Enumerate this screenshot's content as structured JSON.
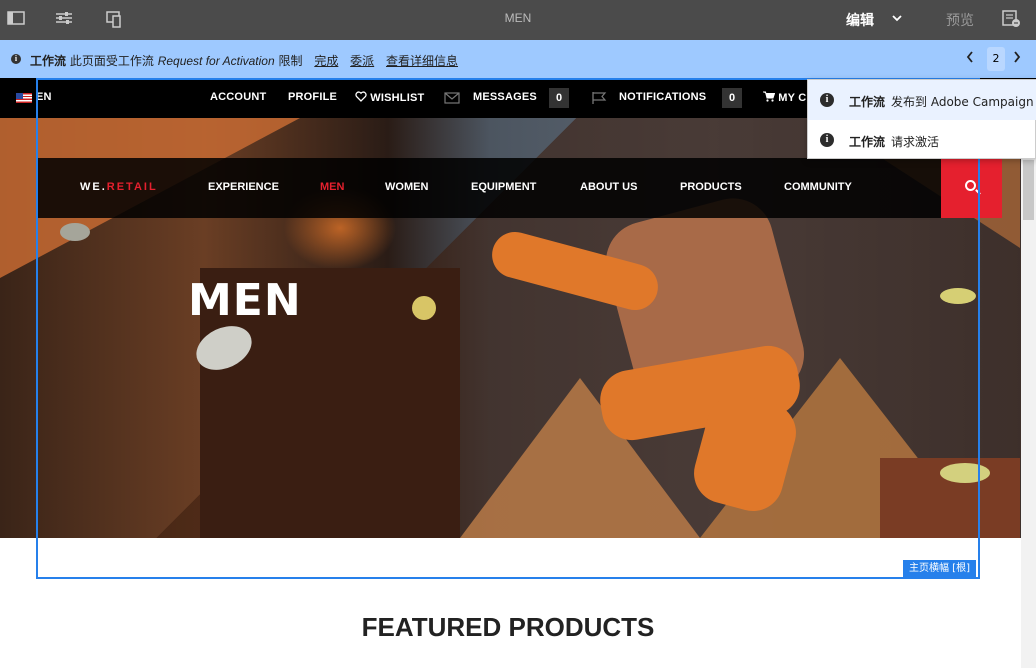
{
  "toolbar": {
    "page_title": "MEN",
    "edit_label": "编辑",
    "preview_label": "预览"
  },
  "infobar": {
    "workflow_label": "工作流",
    "text_before": "此页面受工作流",
    "workflow_name": "Request for Activation",
    "text_after": "限制",
    "link_complete": "完成",
    "link_delegate": "委派",
    "link_details": "查看详细信息",
    "page_indicator": "2"
  },
  "sitenav": {
    "language": "EN",
    "account": "ACCOUNT",
    "profile": "PROFILE",
    "wishlist": "WISHLIST",
    "messages": "MESSAGES",
    "messages_count": "0",
    "notifications": "NOTIFICATIONS",
    "notifications_count": "0",
    "cart": "MY C"
  },
  "mainnav": {
    "logo_prefix": "WE.",
    "logo_suffix": "RETAIL",
    "items": [
      "EXPERIENCE",
      "MEN",
      "WOMEN",
      "EQUIPMENT",
      "ABOUT US",
      "PRODUCTS",
      "COMMUNITY"
    ],
    "active": "MEN"
  },
  "hero": {
    "title": "MEN"
  },
  "component": {
    "label": "主页横幅 [根]"
  },
  "featured": {
    "heading": "FEATURED PRODUCTS"
  },
  "popover": {
    "items": [
      {
        "label": "工作流",
        "text": "发布到 Adobe Campaign"
      },
      {
        "label": "工作流",
        "text": "请求激活"
      }
    ]
  },
  "colors": {
    "accent": "#2680eb",
    "brand_red": "#e5202e",
    "infobar_bg": "#9ec9ff"
  },
  "icons": [
    "sidebar-toggle-icon",
    "properties-icon",
    "emulator-icon",
    "chevron-down-icon",
    "annotate-icon",
    "info-icon",
    "heart-icon",
    "mail-icon",
    "flag-icon",
    "cart-icon",
    "search-icon",
    "chevron-left-icon",
    "chevron-right-icon"
  ]
}
